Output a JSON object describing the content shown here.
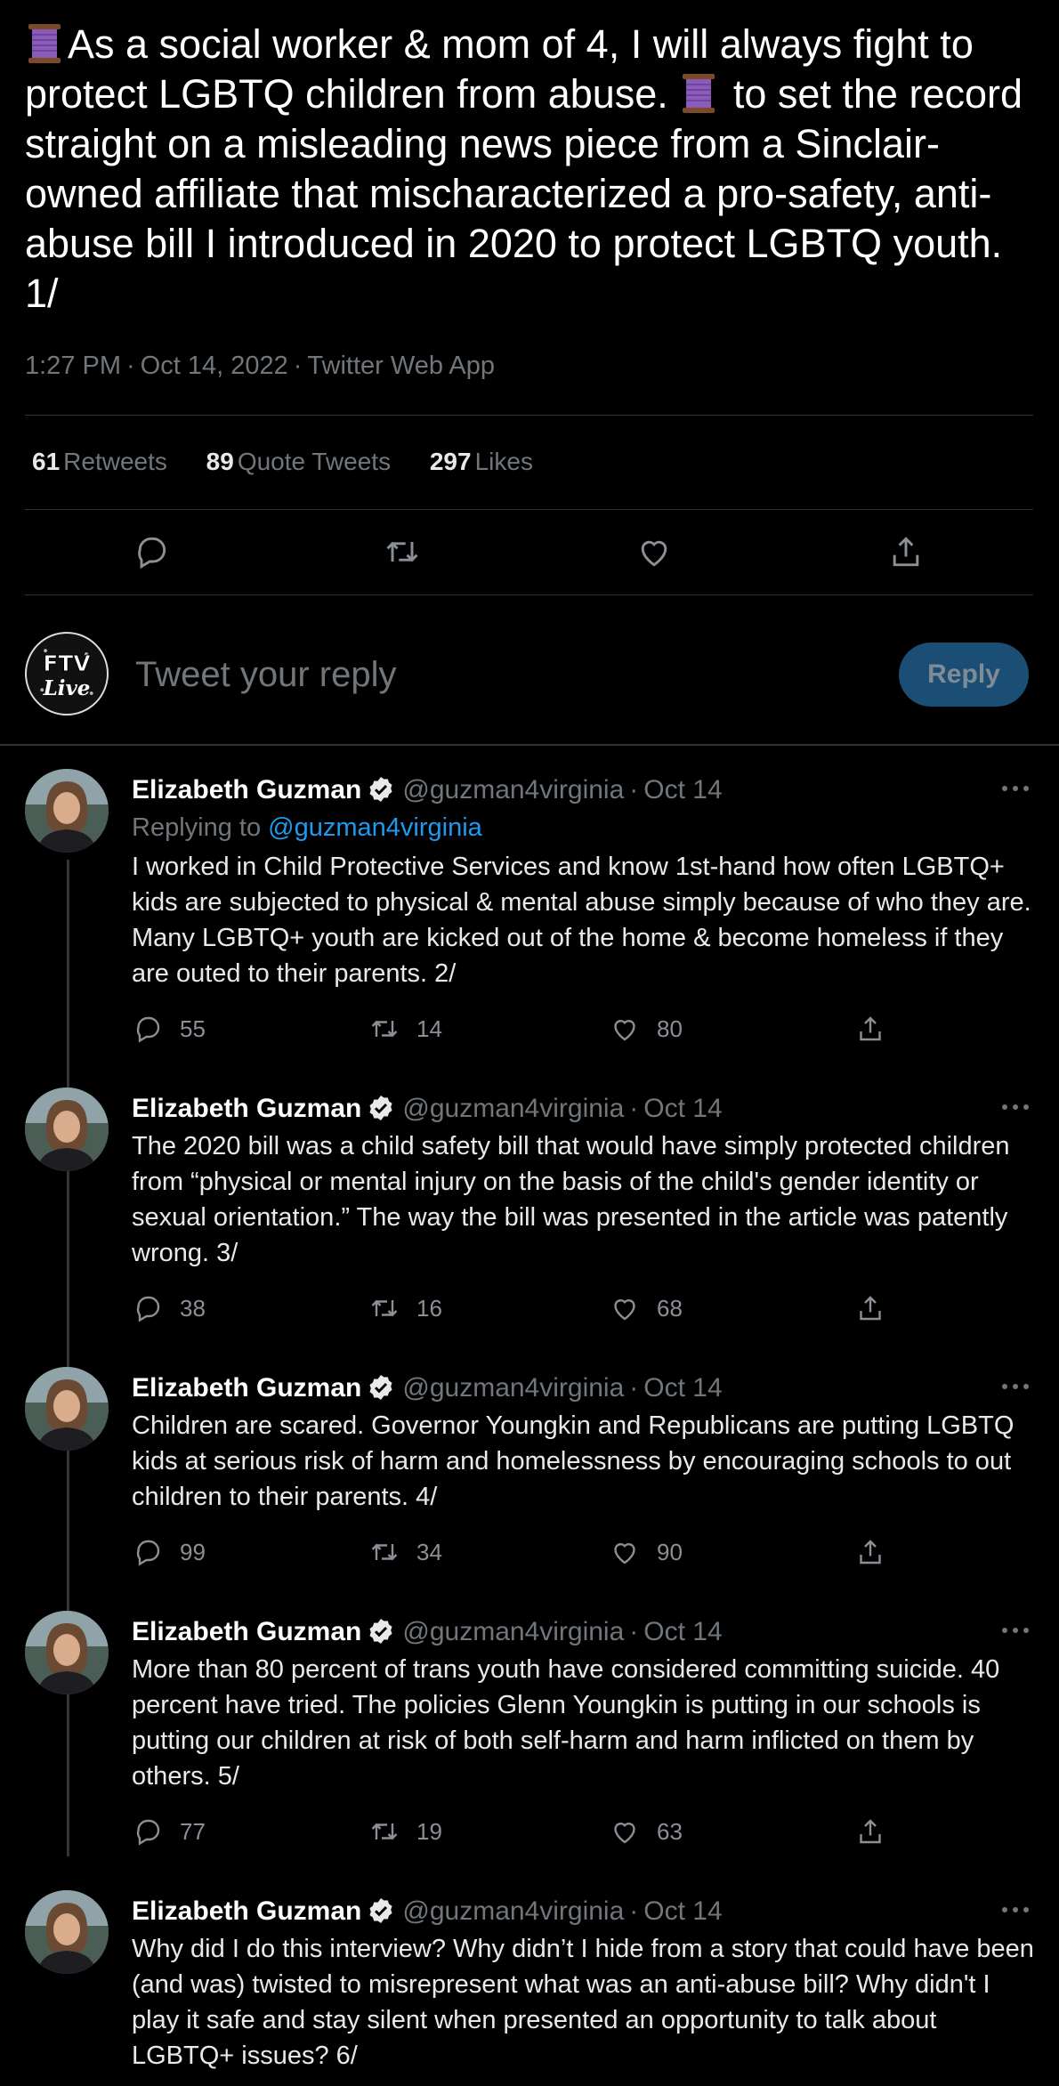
{
  "main_tweet": {
    "text_part1": "As a social worker & mom of 4, I will always fight to protect LGBTQ children from abuse.",
    "text_part2": "to set the record straight on a misleading news piece from a Sinclair-owned affiliate that mischaracterized a pro-safety, anti-abuse bill I introduced in 2020 to protect LGBTQ youth. 1/",
    "emoji_icon": "thread-spool-icon",
    "time": "1:27 PM",
    "date": "Oct 14, 2022",
    "source": "Twitter Web App",
    "stats": [
      {
        "count": "61",
        "label": "Retweets"
      },
      {
        "count": "89",
        "label": "Quote Tweets"
      },
      {
        "count": "297",
        "label": "Likes"
      }
    ],
    "actions": [
      "reply-icon",
      "retweet-icon",
      "like-icon",
      "share-icon"
    ]
  },
  "composer": {
    "avatar_text_top": "FTV",
    "avatar_text_bottom": "Live",
    "placeholder": "Tweet your reply",
    "button_label": "Reply"
  },
  "colors": {
    "background": "#000000",
    "link": "#1d9bf0",
    "muted": "#71767b",
    "reply_button": "#1a4e74"
  },
  "replies": [
    {
      "name": "Elizabeth Guzman",
      "handle": "@guzman4virginia",
      "date": "Oct 14",
      "replying_prefix": "Replying to",
      "replying_to": "@guzman4virginia",
      "text": "I worked in Child Protective Services and know 1st-hand how often LGBTQ+ kids are subjected to physical & mental abuse simply because of who they are. Many LGBTQ+ youth are kicked out of the home & become homeless if they are outed to their parents. 2/",
      "replies": "55",
      "retweets": "14",
      "likes": "80"
    },
    {
      "name": "Elizabeth Guzman",
      "handle": "@guzman4virginia",
      "date": "Oct 14",
      "text": "The 2020 bill was a child safety bill that would have simply protected children from “physical or mental injury on the basis of the child's gender identity or sexual orientation.”  The way the bill was presented in the article was patently wrong. 3/",
      "replies": "38",
      "retweets": "16",
      "likes": "68"
    },
    {
      "name": "Elizabeth Guzman",
      "handle": "@guzman4virginia",
      "date": "Oct 14",
      "text": "Children are scared. Governor Youngkin and Republicans are putting LGBTQ kids at serious risk of harm and homelessness by encouraging schools to out children to their parents. 4/",
      "replies": "99",
      "retweets": "34",
      "likes": "90"
    },
    {
      "name": "Elizabeth Guzman",
      "handle": "@guzman4virginia",
      "date": "Oct 14",
      "text": "More than 80 percent of trans youth have considered committing suicide. 40 percent have tried. The policies Glenn Youngkin is putting in our schools is putting our children at risk of both self-harm and harm inflicted on them by others. 5/",
      "replies": "77",
      "retweets": "19",
      "likes": "63"
    },
    {
      "name": "Elizabeth Guzman",
      "handle": "@guzman4virginia",
      "date": "Oct 14",
      "text": "Why did I do this interview? Why didn’t I hide from a story that could have been (and was) twisted to misrepresent what was an anti-abuse bill? Why didn't I play it safe and stay silent when presented an opportunity to talk about LGBTQ+ issues? 6/"
    }
  ]
}
